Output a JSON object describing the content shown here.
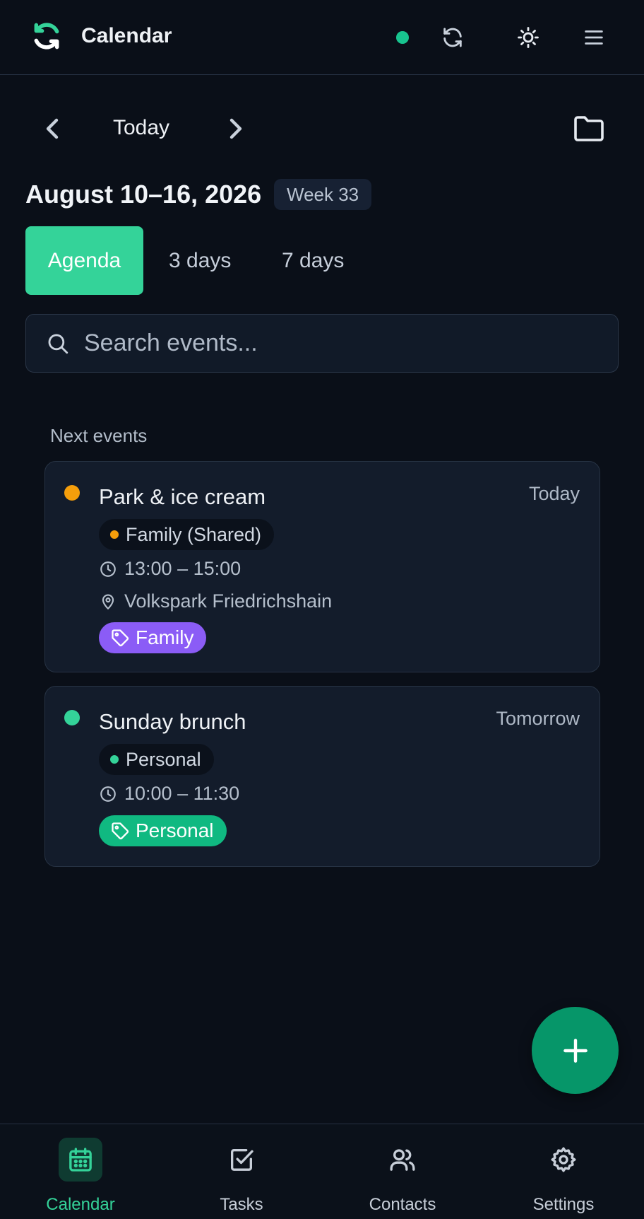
{
  "header": {
    "app_title": "Calendar",
    "status_color": "#18c48f",
    "icons": [
      "sync-logo-icon",
      "refresh-icon",
      "theme-toggle-icon",
      "menu-icon"
    ]
  },
  "nav": {
    "today_label": "Today",
    "icons": [
      "chevron-left-icon",
      "chevron-right-icon",
      "folder-icon"
    ]
  },
  "range": {
    "title": "August 10–16, 2026",
    "week_label": "Week 33"
  },
  "view_tabs": [
    {
      "label": "Agenda",
      "active": true
    },
    {
      "label": "3 days",
      "active": false
    },
    {
      "label": "7 days",
      "active": false
    }
  ],
  "search": {
    "placeholder": "Search events...",
    "value": ""
  },
  "section_label": "Next events",
  "events": [
    {
      "title": "Park & ice cream",
      "when": "Today",
      "dot_color": "#f59e0b",
      "calendar": "Family (Shared)",
      "time": "13:00 – 15:00",
      "location": "Volkspark Friedrichshain",
      "tag": "Family",
      "tag_color": "#8b5cf6"
    },
    {
      "title": "Sunday brunch",
      "when": "Tomorrow",
      "dot_color": "#34d399",
      "calendar": "Personal",
      "time": "10:00 – 11:30",
      "tag": "Personal",
      "tag_color": "#10b981"
    }
  ],
  "bottom_nav": [
    {
      "label": "Calendar",
      "icon": "calendar-icon",
      "active": true
    },
    {
      "label": "Tasks",
      "icon": "checkbox-icon",
      "active": false
    },
    {
      "label": "Contacts",
      "icon": "users-icon",
      "active": false
    },
    {
      "label": "Settings",
      "icon": "gear-icon",
      "active": false
    }
  ],
  "colors": {
    "accent": "#34d399",
    "fab": "#069669",
    "background": "#0a0f18"
  }
}
